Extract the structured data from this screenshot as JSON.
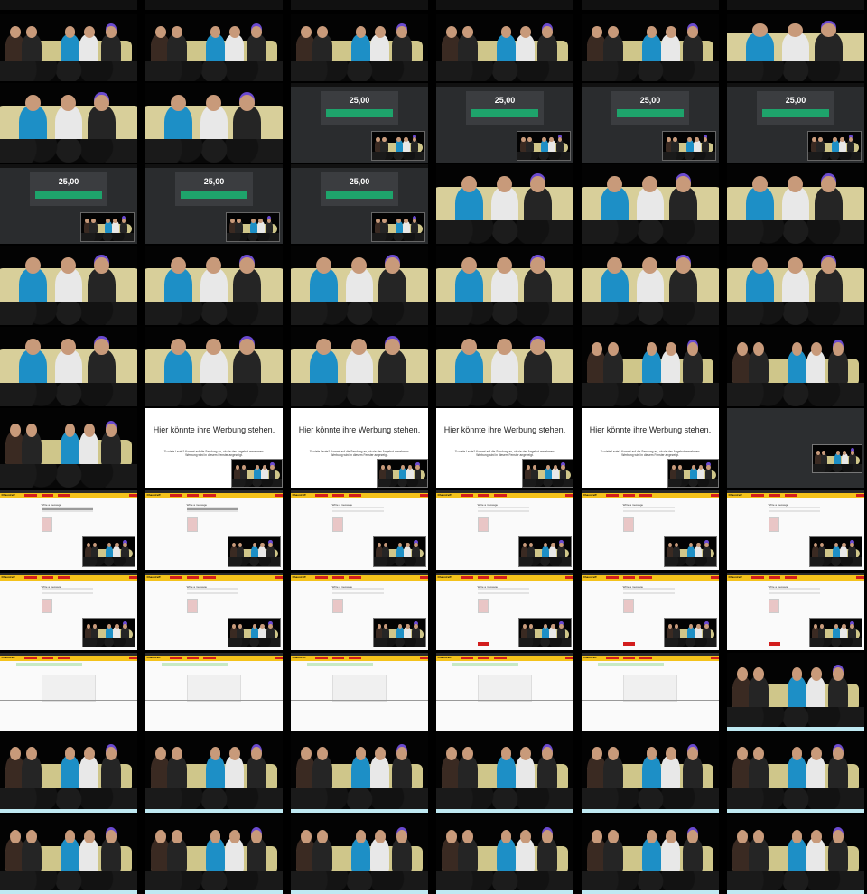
{
  "price_display": "25,00",
  "ad_slide": {
    "title": "Hier könnte ihre Werbung stehen.",
    "body": "Zu viele Leute? Kommt auf die Sendung an, ob sie das Angebot annehmen. Werbung wird in diesem Fenster angezeigt."
  },
  "web_form": {
    "heading": "Write a message"
  },
  "web_page": {
    "brand": "Chaostreff"
  },
  "colors": {
    "stage_black": "#030303",
    "sofa_cream": "#cfc68a",
    "shirt_blue": "#1d8fc6",
    "button_green": "#1ea36b",
    "web_yellow": "#f4c21b",
    "web_red": "#d21d1d"
  }
}
